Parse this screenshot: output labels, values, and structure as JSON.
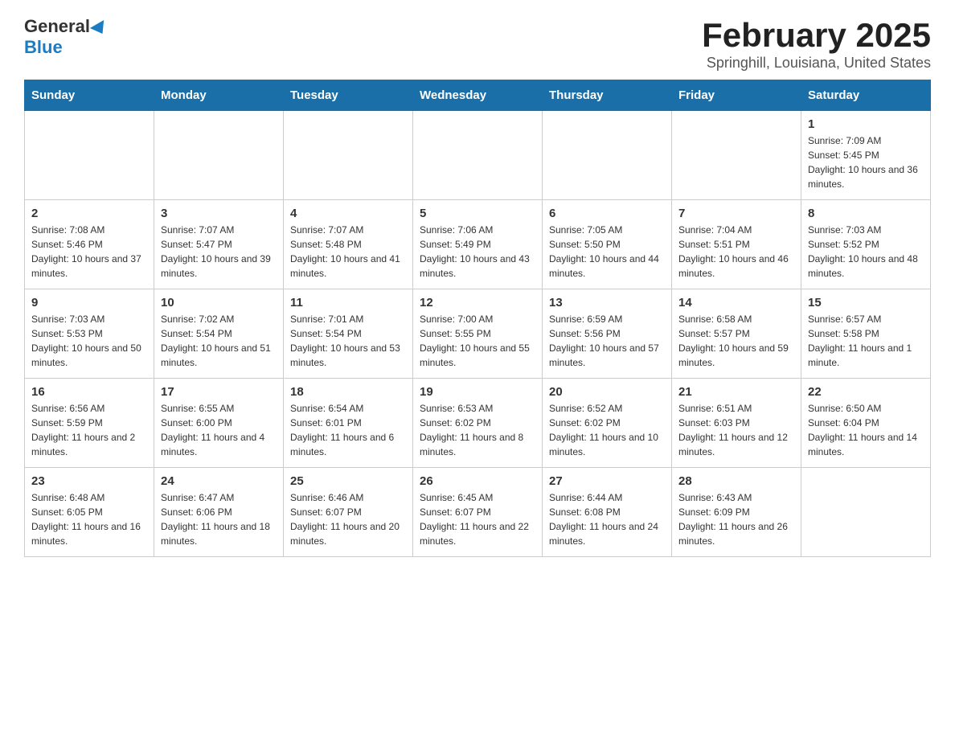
{
  "header": {
    "logo_general": "General",
    "logo_blue": "Blue",
    "title": "February 2025",
    "subtitle": "Springhill, Louisiana, United States"
  },
  "weekdays": [
    "Sunday",
    "Monday",
    "Tuesday",
    "Wednesday",
    "Thursday",
    "Friday",
    "Saturday"
  ],
  "weeks": [
    [
      {
        "day": "",
        "info": ""
      },
      {
        "day": "",
        "info": ""
      },
      {
        "day": "",
        "info": ""
      },
      {
        "day": "",
        "info": ""
      },
      {
        "day": "",
        "info": ""
      },
      {
        "day": "",
        "info": ""
      },
      {
        "day": "1",
        "sunrise": "7:09 AM",
        "sunset": "5:45 PM",
        "daylight": "10 hours and 36 minutes."
      }
    ],
    [
      {
        "day": "2",
        "sunrise": "7:08 AM",
        "sunset": "5:46 PM",
        "daylight": "10 hours and 37 minutes."
      },
      {
        "day": "3",
        "sunrise": "7:07 AM",
        "sunset": "5:47 PM",
        "daylight": "10 hours and 39 minutes."
      },
      {
        "day": "4",
        "sunrise": "7:07 AM",
        "sunset": "5:48 PM",
        "daylight": "10 hours and 41 minutes."
      },
      {
        "day": "5",
        "sunrise": "7:06 AM",
        "sunset": "5:49 PM",
        "daylight": "10 hours and 43 minutes."
      },
      {
        "day": "6",
        "sunrise": "7:05 AM",
        "sunset": "5:50 PM",
        "daylight": "10 hours and 44 minutes."
      },
      {
        "day": "7",
        "sunrise": "7:04 AM",
        "sunset": "5:51 PM",
        "daylight": "10 hours and 46 minutes."
      },
      {
        "day": "8",
        "sunrise": "7:03 AM",
        "sunset": "5:52 PM",
        "daylight": "10 hours and 48 minutes."
      }
    ],
    [
      {
        "day": "9",
        "sunrise": "7:03 AM",
        "sunset": "5:53 PM",
        "daylight": "10 hours and 50 minutes."
      },
      {
        "day": "10",
        "sunrise": "7:02 AM",
        "sunset": "5:54 PM",
        "daylight": "10 hours and 51 minutes."
      },
      {
        "day": "11",
        "sunrise": "7:01 AM",
        "sunset": "5:54 PM",
        "daylight": "10 hours and 53 minutes."
      },
      {
        "day": "12",
        "sunrise": "7:00 AM",
        "sunset": "5:55 PM",
        "daylight": "10 hours and 55 minutes."
      },
      {
        "day": "13",
        "sunrise": "6:59 AM",
        "sunset": "5:56 PM",
        "daylight": "10 hours and 57 minutes."
      },
      {
        "day": "14",
        "sunrise": "6:58 AM",
        "sunset": "5:57 PM",
        "daylight": "10 hours and 59 minutes."
      },
      {
        "day": "15",
        "sunrise": "6:57 AM",
        "sunset": "5:58 PM",
        "daylight": "11 hours and 1 minute."
      }
    ],
    [
      {
        "day": "16",
        "sunrise": "6:56 AM",
        "sunset": "5:59 PM",
        "daylight": "11 hours and 2 minutes."
      },
      {
        "day": "17",
        "sunrise": "6:55 AM",
        "sunset": "6:00 PM",
        "daylight": "11 hours and 4 minutes."
      },
      {
        "day": "18",
        "sunrise": "6:54 AM",
        "sunset": "6:01 PM",
        "daylight": "11 hours and 6 minutes."
      },
      {
        "day": "19",
        "sunrise": "6:53 AM",
        "sunset": "6:02 PM",
        "daylight": "11 hours and 8 minutes."
      },
      {
        "day": "20",
        "sunrise": "6:52 AM",
        "sunset": "6:02 PM",
        "daylight": "11 hours and 10 minutes."
      },
      {
        "day": "21",
        "sunrise": "6:51 AM",
        "sunset": "6:03 PM",
        "daylight": "11 hours and 12 minutes."
      },
      {
        "day": "22",
        "sunrise": "6:50 AM",
        "sunset": "6:04 PM",
        "daylight": "11 hours and 14 minutes."
      }
    ],
    [
      {
        "day": "23",
        "sunrise": "6:48 AM",
        "sunset": "6:05 PM",
        "daylight": "11 hours and 16 minutes."
      },
      {
        "day": "24",
        "sunrise": "6:47 AM",
        "sunset": "6:06 PM",
        "daylight": "11 hours and 18 minutes."
      },
      {
        "day": "25",
        "sunrise": "6:46 AM",
        "sunset": "6:07 PM",
        "daylight": "11 hours and 20 minutes."
      },
      {
        "day": "26",
        "sunrise": "6:45 AM",
        "sunset": "6:07 PM",
        "daylight": "11 hours and 22 minutes."
      },
      {
        "day": "27",
        "sunrise": "6:44 AM",
        "sunset": "6:08 PM",
        "daylight": "11 hours and 24 minutes."
      },
      {
        "day": "28",
        "sunrise": "6:43 AM",
        "sunset": "6:09 PM",
        "daylight": "11 hours and 26 minutes."
      },
      {
        "day": "",
        "info": ""
      }
    ]
  ]
}
